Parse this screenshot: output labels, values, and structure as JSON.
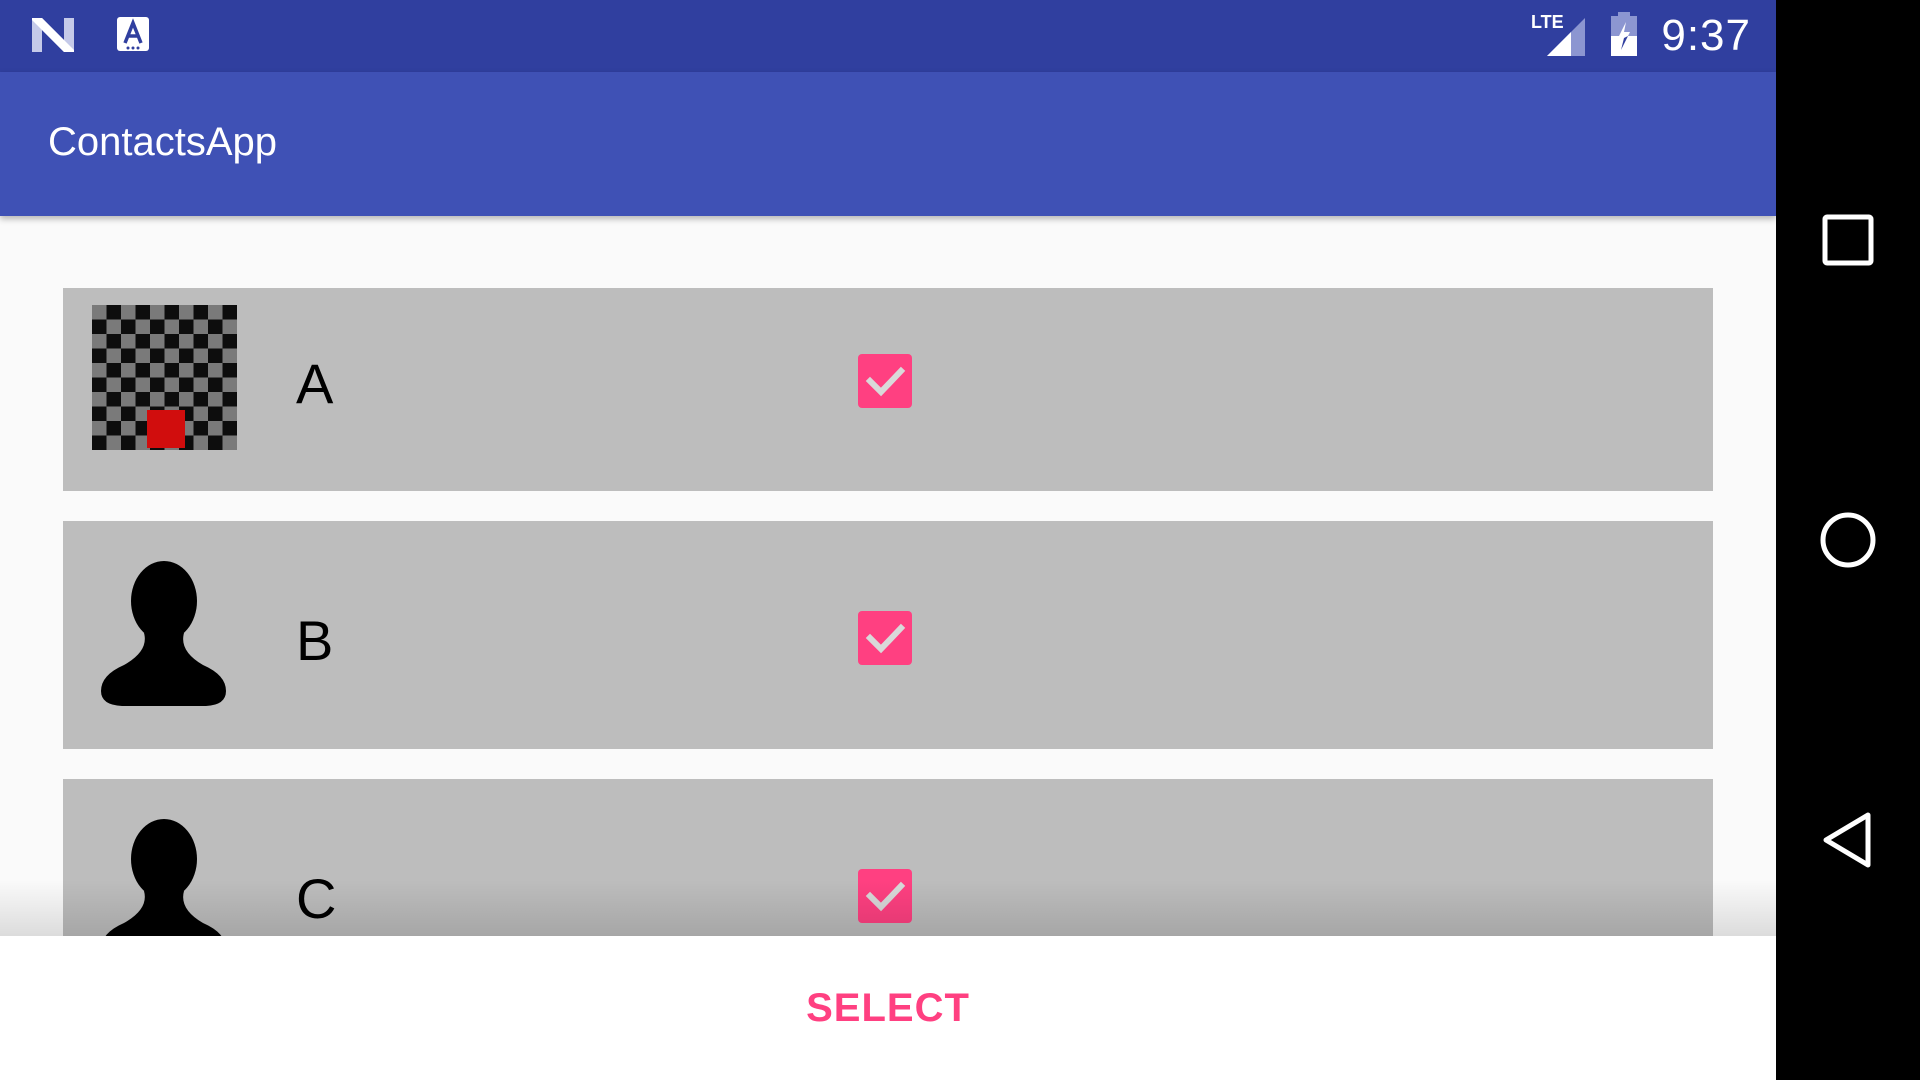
{
  "status_bar": {
    "time": "9:37",
    "network": "LTE",
    "icons": [
      "notification-n-icon",
      "notification-a-icon",
      "lte-signal-icon",
      "battery-charging-icon"
    ]
  },
  "app_bar": {
    "title": "ContactsApp"
  },
  "contacts": [
    {
      "name": "A",
      "avatar": "checker-image",
      "checked": true
    },
    {
      "name": "B",
      "avatar": "person-icon",
      "checked": true
    },
    {
      "name": "C",
      "avatar": "person-icon",
      "checked": true
    }
  ],
  "bottom_bar": {
    "select_label": "SELECT"
  },
  "nav_bar": {
    "icons": [
      "recents-icon",
      "home-icon",
      "back-icon"
    ]
  },
  "colors": {
    "status_bar": "#303f9f",
    "app_bar": "#3f51b5",
    "accent": "#ff4081",
    "row_background": "#bdbdbd"
  }
}
